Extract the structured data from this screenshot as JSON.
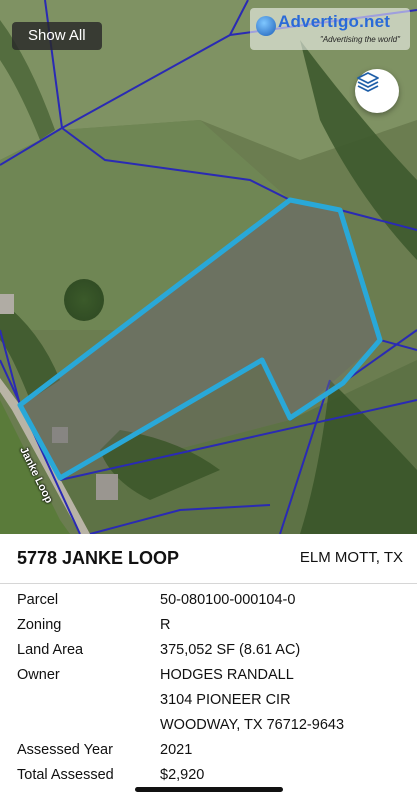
{
  "map": {
    "show_all_label": "Show All",
    "layers_icon": "layers-icon",
    "road_label": "Janke Loop",
    "parcel_outline_color": "#29a8d8",
    "boundary_line_color": "#2a2ab4",
    "watermark": {
      "brand": "Advertigo.net",
      "tagline": "\"Advertising the world\""
    }
  },
  "property": {
    "address": "5778 JANKE LOOP",
    "city": "ELM MOTT, TX",
    "details": [
      {
        "label": "Parcel",
        "value": "50-080100-000104-0"
      },
      {
        "label": "Zoning",
        "value": "R"
      },
      {
        "label": "Land Area",
        "value": "375,052 SF (8.61 AC)"
      },
      {
        "label": "Owner",
        "value": "HODGES RANDALL"
      },
      {
        "label": "",
        "value": "3104 PIONEER CIR"
      },
      {
        "label": "",
        "value": "WOODWAY, TX 76712-9643"
      },
      {
        "label": "Assessed Year",
        "value": "2021"
      },
      {
        "label": "Total Assessed",
        "value": "$2,920"
      }
    ]
  }
}
